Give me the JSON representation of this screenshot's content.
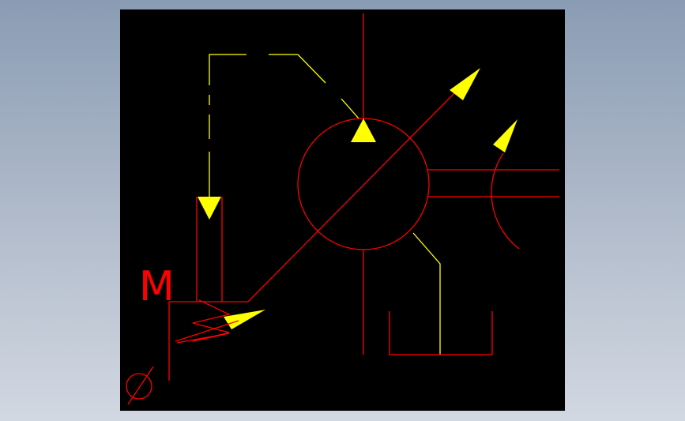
{
  "viewer": {
    "background_color": "#000000",
    "page_gradient": [
      "#8a9cb4",
      "#d2d8e2"
    ]
  },
  "drawing": {
    "symbol": "variable-displacement-pump",
    "line_color": "#ff0000",
    "pilot_line_color": "#ffff00",
    "arrow_color": "#ffff00",
    "labels": {
      "motor_letter": "M",
      "diameter_symbol": "Ø"
    }
  }
}
